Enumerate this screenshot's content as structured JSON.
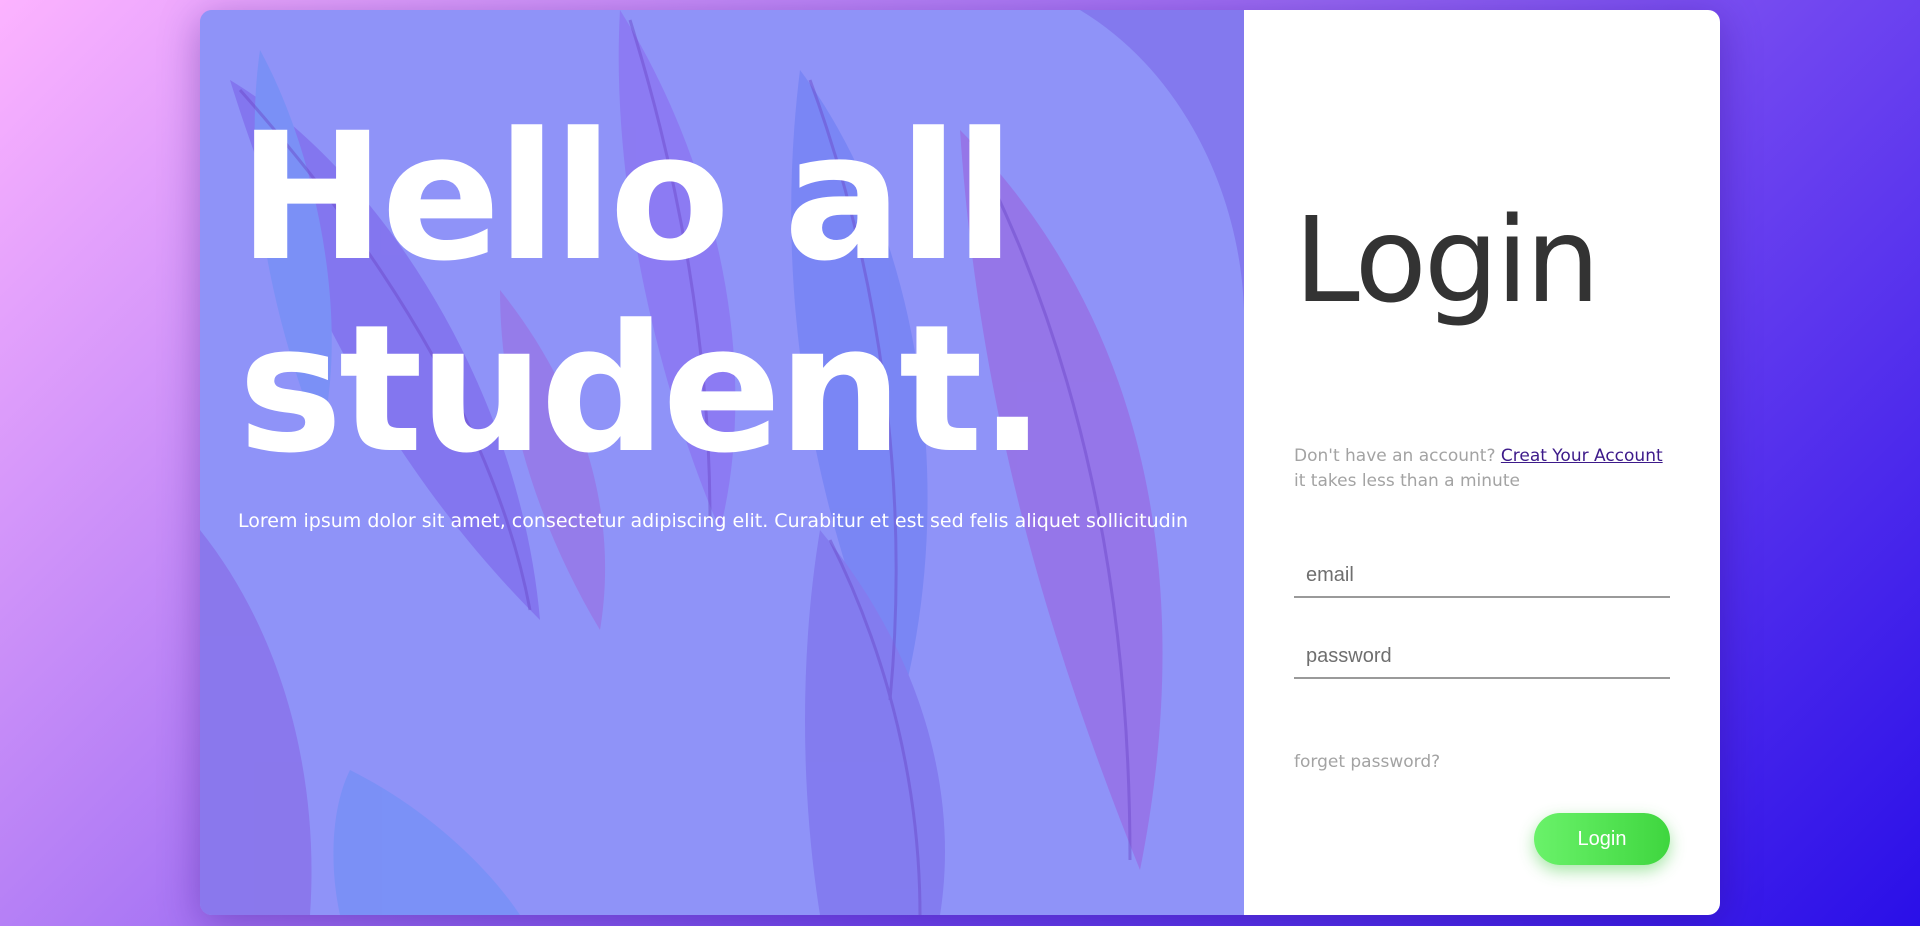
{
  "hero": {
    "title_line1": "Hello all",
    "title_line2": "student.",
    "subtitle": "Lorem ipsum dolor sit amet, consectetur adipiscing elit. Curabitur et est sed felis aliquet sollicitudin"
  },
  "login": {
    "heading": "Login",
    "signup_prefix": "Don't have an account?",
    "signup_link": "Creat Your Account",
    "signup_suffix": "it takes less than a minute",
    "email_placeholder": "email",
    "password_placeholder": "password",
    "forgot_label": "forget password?",
    "button_label": "Login"
  },
  "colors": {
    "background_start": "#fcb3ff",
    "background_end": "#2a0fe8",
    "hero_overlay": "#8f93f8",
    "button": "#5ee65e",
    "link": "#3d1a8a"
  },
  "icons": {
    "background_art": "feather-pattern"
  }
}
